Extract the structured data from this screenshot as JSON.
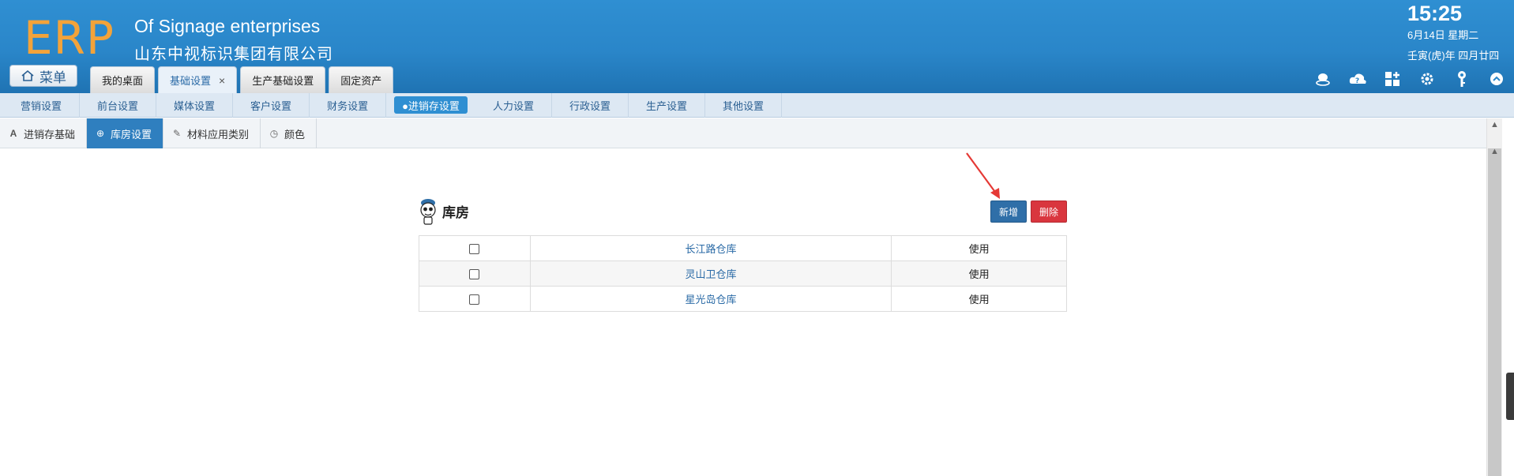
{
  "header": {
    "logo": "ERP",
    "company_en": "Of Signage enterprises",
    "company_cn": "山东中视标识集团有限公司",
    "time": "15:25",
    "date": "6月14日 星期二",
    "lunar": "壬寅(虎)年 四月廿四",
    "menu_label": "菜单",
    "tabs": [
      {
        "label": "我的桌面"
      },
      {
        "label": "基础设置",
        "close": "×"
      },
      {
        "label": "生产基础设置"
      },
      {
        "label": "固定资产"
      }
    ]
  },
  "module_nav": [
    "营销设置",
    "前台设置",
    "媒体设置",
    "客户设置",
    "财务设置",
    "●进销存设置",
    "人力设置",
    "行政设置",
    "生产设置",
    "其他设置"
  ],
  "sub_nav": [
    {
      "icon": "A",
      "label": "进销存基础"
    },
    {
      "icon": "⊕",
      "label": "库房设置"
    },
    {
      "icon": "✎",
      "label": "材料应用类别"
    },
    {
      "icon": "◷",
      "label": "颜色"
    }
  ],
  "panel": {
    "title": "库房",
    "new_button": "新增",
    "delete_button": "删除"
  },
  "warehouses": [
    {
      "name": "长江路仓库",
      "status": "使用"
    },
    {
      "name": "灵山卫仓库",
      "status": "使用"
    },
    {
      "name": "星光岛仓库",
      "status": "使用"
    }
  ],
  "colors": {
    "header": "#2f8fd2",
    "logo": "#f3a33a",
    "new_button": "#2f6fa8",
    "delete_button": "#d9363e"
  }
}
